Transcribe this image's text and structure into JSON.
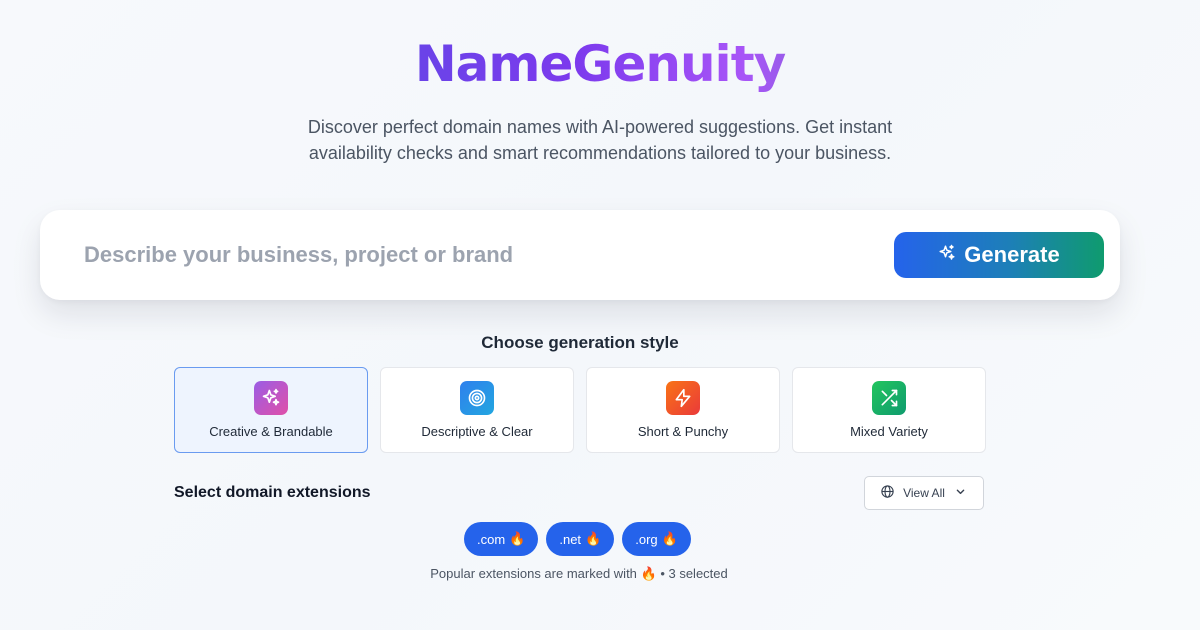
{
  "brand": {
    "name": "NameGenuity"
  },
  "hero": {
    "subtitle_line1": "Discover perfect domain names with AI-powered suggestions. Get instant",
    "subtitle_line2": "availability checks and smart recommendations tailored to your business."
  },
  "search": {
    "placeholder": "Describe your business, project or brand",
    "value": "",
    "generate_label": "Generate",
    "generate_icon": "sparkles-icon"
  },
  "styles": {
    "heading": "Choose generation style",
    "options": [
      {
        "label": "Creative & Brandable",
        "icon": "sparkles-icon",
        "color": "#b649d6",
        "selected": true
      },
      {
        "label": "Descriptive & Clear",
        "icon": "target-icon",
        "color": "#3b82f6",
        "selected": false
      },
      {
        "label": "Short & Punchy",
        "icon": "lightning-icon",
        "color": "#f05a28",
        "selected": false
      },
      {
        "label": "Mixed Variety",
        "icon": "shuffle-icon",
        "color": "#16a34a",
        "selected": false
      }
    ]
  },
  "extensions": {
    "heading": "Select domain extensions",
    "view_all_label": "View All",
    "chips": [
      {
        "label": ".com",
        "popular": "🔥"
      },
      {
        "label": ".net",
        "popular": "🔥"
      },
      {
        "label": ".org",
        "popular": "🔥"
      }
    ],
    "note": "Popular extensions are marked with 🔥 • 3 selected"
  },
  "colors": {
    "primary": "#2563eb",
    "accent_green": "#0f9b6e",
    "selected_card_bg": "#eef4fe",
    "selected_card_border": "#6a9bf0"
  }
}
